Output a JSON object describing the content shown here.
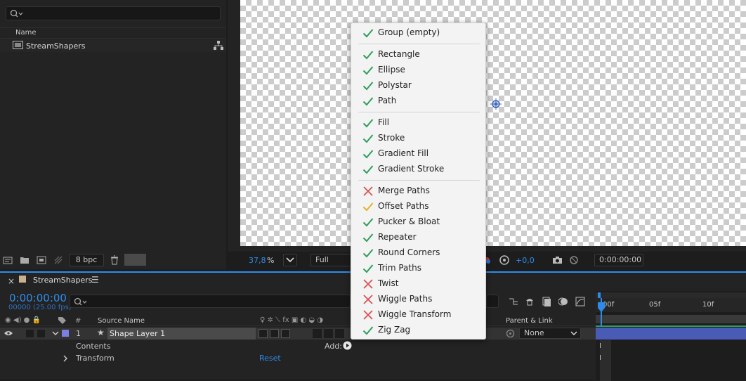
{
  "project": {
    "search_placeholder": "",
    "column_name": "Name",
    "item_name": "StreamShapers",
    "bpc": "8 bpc"
  },
  "viewer": {
    "zoom": "37,8",
    "zoom_unit": "%",
    "resolution": "Full",
    "exposure": "+0,0",
    "timecode": "0:00:00:00"
  },
  "timeline": {
    "comp_name": "StreamShapers",
    "current_time": "0:00:00:00",
    "frame_info": "00000 (25.00 fps)",
    "col_num": "#",
    "col_source": "Source Name",
    "col_parent": "Parent & Link",
    "layer_num": "1",
    "layer_name": "Shape Layer 1",
    "parent_value": "None",
    "contents_label": "Contents",
    "add_label": "Add:",
    "transform_label": "Transform",
    "reset_label": "Reset",
    "ruler": [
      "00f",
      "05f",
      "10f"
    ]
  },
  "menu": {
    "groups": [
      [
        {
          "label": "Group (empty)",
          "status": "check"
        }
      ],
      [
        {
          "label": "Rectangle",
          "status": "check"
        },
        {
          "label": "Ellipse",
          "status": "check"
        },
        {
          "label": "Polystar",
          "status": "check"
        },
        {
          "label": "Path",
          "status": "check"
        }
      ],
      [
        {
          "label": "Fill",
          "status": "check"
        },
        {
          "label": "Stroke",
          "status": "check"
        },
        {
          "label": "Gradient Fill",
          "status": "check"
        },
        {
          "label": "Gradient Stroke",
          "status": "check"
        }
      ],
      [
        {
          "label": "Merge Paths",
          "status": "cross"
        },
        {
          "label": "Offset Paths",
          "status": "partial"
        },
        {
          "label": "Pucker & Bloat",
          "status": "check"
        },
        {
          "label": "Repeater",
          "status": "check"
        },
        {
          "label": "Round Corners",
          "status": "check"
        },
        {
          "label": "Trim Paths",
          "status": "check"
        },
        {
          "label": "Twist",
          "status": "cross"
        },
        {
          "label": "Wiggle Paths",
          "status": "cross"
        },
        {
          "label": "Wiggle Transform",
          "status": "cross"
        },
        {
          "label": "Zig Zag",
          "status": "check"
        }
      ]
    ]
  },
  "colors": {
    "check": "#2e9e5b",
    "cross": "#d9534f",
    "partial": "#e0b32a",
    "accent": "#2d8ceb",
    "label_purple": "#7b7fe0"
  }
}
